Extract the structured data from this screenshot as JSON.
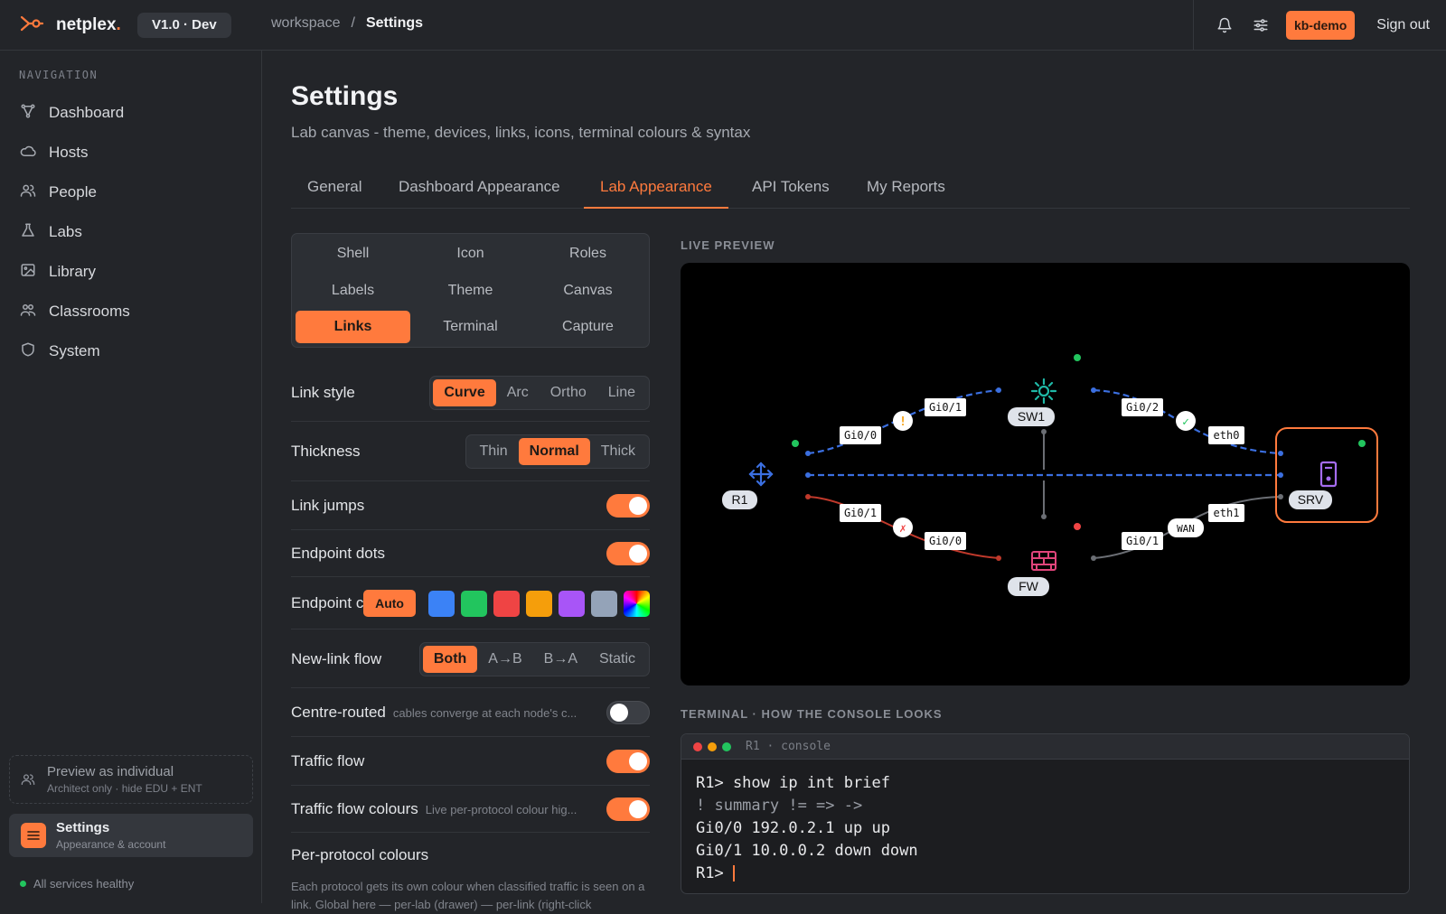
{
  "brand": {
    "name": "netplex",
    "version": "V1.0 · Dev"
  },
  "breadcrumb": {
    "root": "workspace",
    "sep": "/",
    "current": "Settings"
  },
  "topbar": {
    "user": "kb-demo",
    "signout": "Sign out"
  },
  "sidebar": {
    "heading": "NAVIGATION",
    "items": [
      {
        "label": "Dashboard",
        "icon": "topology-icon"
      },
      {
        "label": "Hosts",
        "icon": "cloud-icon"
      },
      {
        "label": "People",
        "icon": "people-icon"
      },
      {
        "label": "Labs",
        "icon": "flask-icon"
      },
      {
        "label": "Library",
        "icon": "image-icon"
      },
      {
        "label": "Classrooms",
        "icon": "classroom-icon"
      },
      {
        "label": "System",
        "icon": "shield-icon"
      }
    ],
    "preview": {
      "title": "Preview as individual",
      "sub": "Architect only · hide EDU + ENT"
    },
    "settings": {
      "title": "Settings",
      "sub": "Appearance & account"
    },
    "status": "All services healthy"
  },
  "page": {
    "title": "Settings",
    "subtitle": "Lab canvas - theme, devices, links, icons, terminal colours & syntax"
  },
  "tabs": [
    "General",
    "Dashboard Appearance",
    "Lab Appearance",
    "API Tokens",
    "My Reports"
  ],
  "active_tab": "Lab Appearance",
  "subtabs": [
    "Shell",
    "Icon",
    "Roles",
    "Labels",
    "Theme",
    "Canvas",
    "Links",
    "Terminal",
    "Capture"
  ],
  "active_subtab": "Links",
  "settings": {
    "link_style": {
      "label": "Link style",
      "options": [
        "Curve",
        "Arc",
        "Ortho",
        "Line"
      ],
      "selected": "Curve"
    },
    "thickness": {
      "label": "Thickness",
      "options": [
        "Thin",
        "Normal",
        "Thick"
      ],
      "selected": "Normal"
    },
    "link_jumps": {
      "label": "Link jumps",
      "on": true
    },
    "endpoint_dots": {
      "label": "Endpoint dots",
      "on": true
    },
    "endpoint_colour": {
      "label": "Endpoint c",
      "auto": "Auto",
      "swatches": [
        "#3b82f6",
        "#22c55e",
        "#ef4444",
        "#f59e0b",
        "#a855f7",
        "#94a3b8",
        "rainbow"
      ]
    },
    "new_link_flow": {
      "label": "New-link flow",
      "options": [
        "Both",
        "A→B",
        "B→A",
        "Static"
      ],
      "selected": "Both"
    },
    "centre_routed": {
      "label": "Centre-routed",
      "hint": "cables converge at each node's c...",
      "on": false
    },
    "traffic_flow": {
      "label": "Traffic flow",
      "on": true
    },
    "traffic_flow_colours": {
      "label": "Traffic flow colours",
      "hint": "Live per-protocol colour hig...",
      "on": true
    },
    "per_protocol": {
      "label": "Per-protocol colours",
      "desc": "Each protocol gets its own colour when classified traffic is seen on a link. Global here — per-lab (drawer) — per-link (right-click"
    }
  },
  "preview": {
    "heading": "LIVE PREVIEW",
    "nodes": {
      "r1": "R1",
      "sw1": "SW1",
      "fw": "FW",
      "srv": "SRV"
    },
    "ports": {
      "r1_sw1_a": "Gi0/0",
      "r1_sw1_b": "Gi0/1",
      "sw1_srv_a": "Gi0/2",
      "sw1_srv_b": "eth0",
      "r1_fw_a": "Gi0/1",
      "r1_fw_b": "Gi0/0",
      "fw_srv_a": "Gi0/1",
      "fw_srv_b": "eth1"
    },
    "link_badges": {
      "warn": "!",
      "ok": "✓",
      "down": "✗",
      "wan": "WAN"
    }
  },
  "terminal": {
    "heading": "TERMINAL · HOW THE CONSOLE LOOKS",
    "title": "R1 · console",
    "lines": [
      "R1> show ip int brief",
      "! summary != => ->",
      "Gi0/0 192.0.2.1 up up",
      "Gi0/1 10.0.0.2 down down",
      "R1> "
    ]
  },
  "colors": {
    "accent": "#ff7a3d",
    "link_blue": "#3b6fe0",
    "link_red": "#c0392b",
    "switch_teal": "#1fb8a6",
    "firewall_pink": "#e0457b",
    "server_purple": "#a56cf0"
  }
}
